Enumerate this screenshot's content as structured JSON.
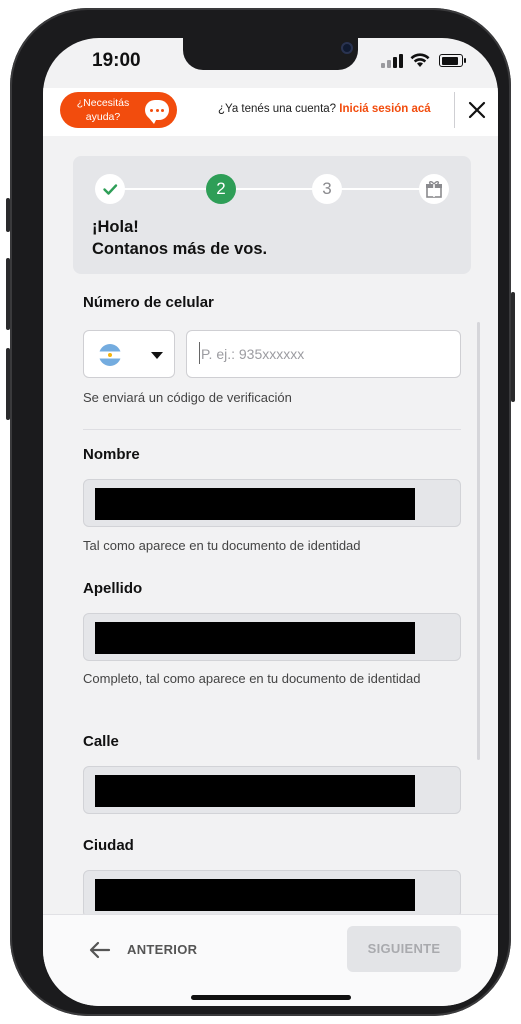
{
  "status_bar": {
    "time": "19:00"
  },
  "header": {
    "help_label": "¿Necesitás\nayuda?",
    "account_question": "¿Ya tenés una cuenta?",
    "login_link": "Iniciá sesión acá"
  },
  "steps": {
    "items": [
      "2",
      "3"
    ],
    "current": 2,
    "greeting_line1": "¡Hola!",
    "greeting_line2": "Contanos más de vos."
  },
  "form": {
    "phone": {
      "label": "Número de celular",
      "country": "Argentina",
      "placeholder": "P. ej.: 935xxxxxx",
      "value": "",
      "hint": "Se enviará un código de verificación"
    },
    "nombre": {
      "label": "Nombre",
      "hint": "Tal como aparece en tu documento de identidad"
    },
    "apellido": {
      "label": "Apellido",
      "hint": "Completo, tal como aparece en tu documento de identidad"
    },
    "calle": {
      "label": "Calle"
    },
    "ciudad": {
      "label": "Ciudad"
    }
  },
  "footer": {
    "back_label": "ANTERIOR",
    "next_label": "SIGUIENTE"
  },
  "colors": {
    "accent": "#f24c0d",
    "step_active": "#2e9e57",
    "background": "#f2f2f3"
  }
}
